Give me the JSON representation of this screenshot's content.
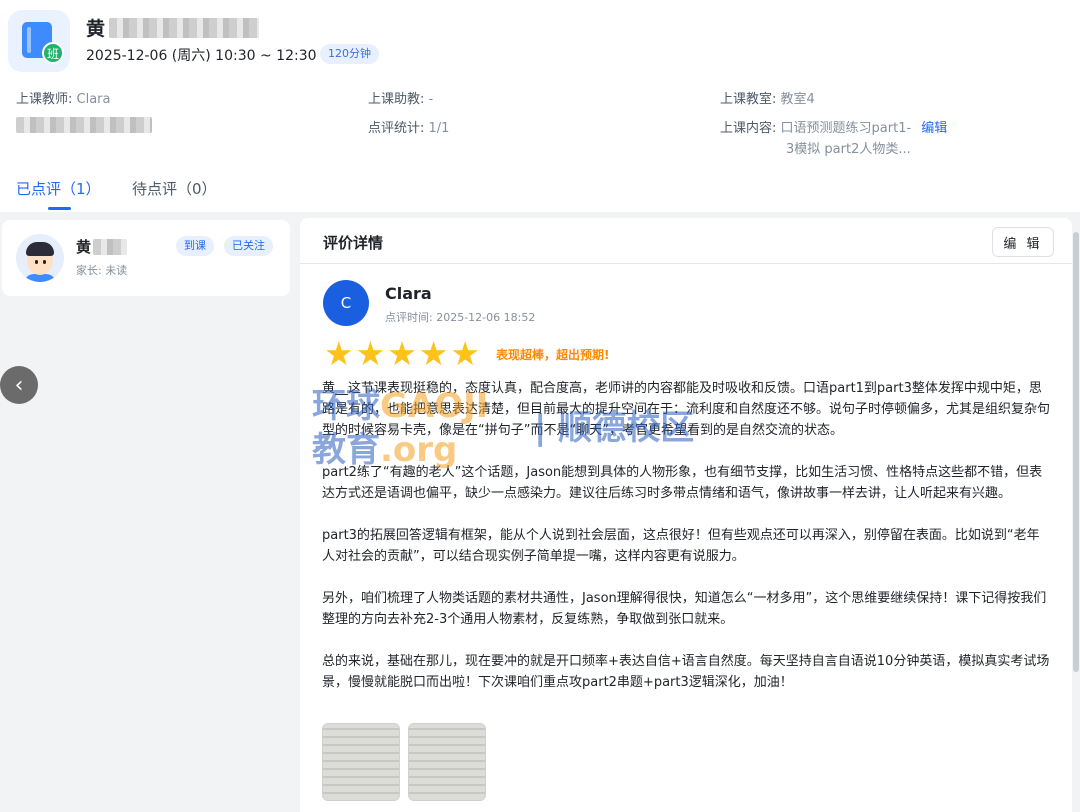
{
  "class": {
    "title_prefix": "黄",
    "time": "2025-12-06 (周六) 10:30 ~ 12:30",
    "duration": "120分钟",
    "icon_badge": "班"
  },
  "info": {
    "teacher_label": "上课教师:",
    "teacher_value": "Clara",
    "assistant_label": "上课助教:",
    "assistant_value": "-",
    "classroom_label": "上课教室:",
    "classroom_value": "教室4",
    "review_stats_label": "点评统计:",
    "review_stats_value": "1/1",
    "content_label": "上课内容:",
    "content_value_line1": "口语预测题练习part1-",
    "content_value_line2": "3模拟 part2人物类...",
    "content_edit": "编辑"
  },
  "tabs": [
    {
      "label": "已点评（1）"
    },
    {
      "label": "待点评（0）"
    }
  ],
  "student": {
    "name_prefix": "黄",
    "parent_status": "家长: 未读",
    "tag_attended": "到课",
    "tag_followed": "已关注"
  },
  "detail": {
    "title": "评价详情",
    "edit_button": "编 辑",
    "teacher_initial": "C",
    "teacher_name": "Clara",
    "review_time": "点评时间: 2025-12-06 18:52",
    "stars": 5,
    "rating_text": "表现超棒，超出预期!",
    "paragraphs": [
      "黄__这节课表现挺稳的，态度认真，配合度高，老师讲的内容都能及时吸收和反馈。口语part1到part3整体发挥中规中矩，思路是有的，也能把意思表达清楚，但目前最大的提升空间在于：流利度和自然度还不够。说句子时停顿偏多，尤其是组织复杂句型的时候容易卡壳，像是在“拼句子”而不是“聊天”，考官更希望看到的是自然交流的状态。",
      "part2练了“有趣的老人”这个话题，Jason能想到具体的人物形象，也有细节支撑，比如生活习惯、性格特点这些都不错，但表达方式还是语调也偏平，缺少一点感染力。建议往后练习时多带点情绪和语气，像讲故事一样去讲，让人听起来有兴趣。",
      "part3的拓展回答逻辑有框架，能从个人说到社会层面，这点很好！但有些观点还可以再深入，别停留在表面。比如说到“老年人对社会的贡献”，可以结合现实例子简单提一嘴，这样内容更有说服力。",
      "另外，咱们梳理了人物类话题的素材共通性，Jason理解得很快，知道怎么“一材多用”，这个思维要继续保持！课下记得按我们整理的方向去补充2-3个通用人物素材，反复练熟，争取做到张口就来。",
      "总的来说，基础在那儿，现在要冲的就是开口频率+表达自信+语言自然度。每天坚持自言自语说10分钟英语，模拟真实考试场景，慢慢就能脱口而出啦！下次课咱们重点攻part2串题+part3逻辑深化，加油！"
    ]
  },
  "watermark": {
    "line1_a": "环球",
    "line1_b": "GAOJI",
    "line2_a": "教育",
    "line2_b": ".org",
    "right": "| 顺德校区"
  },
  "colors": {
    "accent": "#2468f2",
    "star": "#ffc21a",
    "rating": "#ff8a00"
  }
}
